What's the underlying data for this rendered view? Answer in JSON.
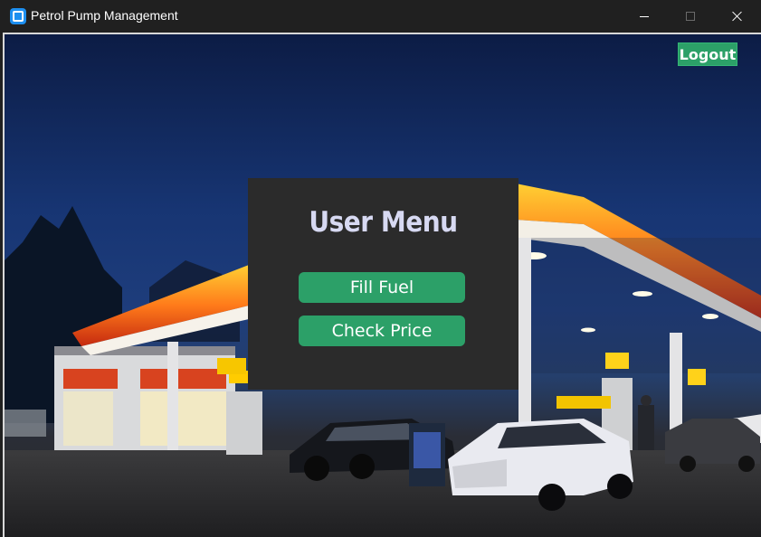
{
  "window": {
    "title": "Petrol Pump Management",
    "icon": "app-icon",
    "controls": [
      "minimize-icon",
      "maximize-icon",
      "close-icon"
    ]
  },
  "header": {
    "logout_label": "Logout"
  },
  "menu": {
    "title": "User Menu",
    "buttons": [
      {
        "label": "Fill Fuel"
      },
      {
        "label": "Check Price"
      }
    ]
  },
  "colors": {
    "accent_green": "#2ca068",
    "panel_bg": "#2b2b2b",
    "title_text": "#d7d9f2",
    "titlebar_bg": "#202020"
  }
}
